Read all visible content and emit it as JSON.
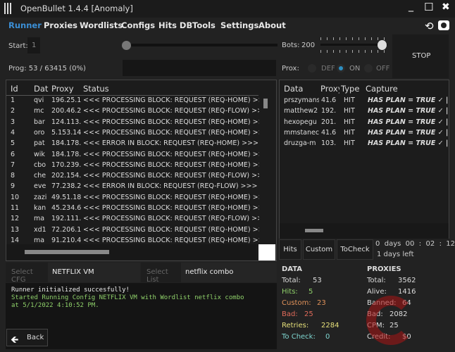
{
  "window": {
    "title": "OpenBullet 1.4.4 [Anomaly]",
    "minimize": "_",
    "maximize": "☐",
    "close": "✖"
  },
  "menu": [
    "Runner",
    "Proxies",
    "Wordlists",
    "Configs",
    "Hits DB",
    "Tools",
    "Settings",
    "About"
  ],
  "accent": "#3b8fd6",
  "controls": {
    "start_label": "Start:",
    "start_value": "1",
    "prog_label": "Prog: 53 / 63415 (0%)",
    "bots_label": "Bots:",
    "bots_value": "200",
    "prox_label": "Prox:",
    "prox_options": [
      "DEF",
      "ON",
      "OFF"
    ],
    "prox_selected": "ON",
    "stop": "STOP",
    "progress_percent": 0
  },
  "left_grid": {
    "headers": [
      "Id",
      "Dat",
      "Proxy",
      "Status"
    ],
    "rows": [
      [
        "1",
        "qvi",
        "196.25.1",
        "<<< PROCESSING BLOCK: REQUEST (REQ-HOME) >>>"
      ],
      [
        "2",
        "mc",
        "200.46.2",
        "<<< PROCESSING BLOCK: REQUEST (REQ-FLOW) >>>"
      ],
      [
        "3",
        "bar",
        "124.113.",
        "<<< PROCESSING BLOCK: REQUEST (REQ-HOME) >>>"
      ],
      [
        "4",
        "oro",
        "5.153.14",
        "<<< PROCESSING BLOCK: REQUEST (REQ-HOME) >>>"
      ],
      [
        "5",
        "pat",
        "184.178.",
        "<<< ERROR IN BLOCK: REQUEST (REQ-HOME) >>>"
      ],
      [
        "6",
        "wik",
        "184.178.",
        "<<< PROCESSING BLOCK: REQUEST (REQ-HOME) >>>"
      ],
      [
        "7",
        "cbo",
        "170.239.",
        "<<< PROCESSING BLOCK: REQUEST (REQ-HOME) >>>"
      ],
      [
        "8",
        "che",
        "202.154.",
        "<<< PROCESSING BLOCK: REQUEST (REQ-FLOW) >>>"
      ],
      [
        "9",
        "eve",
        "77.238.2",
        "<<< ERROR IN BLOCK: REQUEST (REQ-FLOW) >>>"
      ],
      [
        "10",
        "zazi",
        "49.51.18",
        "<<< PROCESSING BLOCK: REQUEST (REQ-HOME) >>>"
      ],
      [
        "11",
        "kan",
        "45.234.6",
        "<<< PROCESSING BLOCK: REQUEST (REQ-HOME) >>>"
      ],
      [
        "12",
        "ma",
        "192.111.",
        "<<< PROCESSING BLOCK: REQUEST (REQ-FLOW) >>>"
      ],
      [
        "13",
        "xd1",
        "72.206.1",
        "<<< PROCESSING BLOCK: REQUEST (REQ-HOME) >>>"
      ],
      [
        "14",
        "ma",
        "91.210.4",
        "<<< PROCESSING BLOCK: REQUEST (REQ-HOME) >>>"
      ]
    ]
  },
  "right_grid": {
    "headers": [
      "Data",
      "Proxy",
      "Type",
      "Capture"
    ],
    "rows": [
      [
        "prszymans",
        "41.6",
        "HIT",
        "HAS PLAN = TRUE ✓ | CON"
      ],
      [
        "matthew2",
        "192.",
        "HIT",
        "HAS PLAN = TRUE ✓ | CON"
      ],
      [
        "hexopegu",
        "201.",
        "HIT",
        "HAS PLAN = TRUE ✓ | CON"
      ],
      [
        "mmstanec",
        "41.6",
        "HIT",
        "HAS PLAN = TRUE ✓ | CON"
      ],
      [
        "druzga-m",
        "103.",
        "HIT",
        "HAS PLAN = TRUE ✓ | CON"
      ]
    ]
  },
  "tabs": [
    "Hits",
    "Custom",
    "ToCheck"
  ],
  "timer": {
    "elapsed": "0  days  00  :  02  :  12",
    "left": "1 days left"
  },
  "select": {
    "cfg_label": "Select CFG",
    "cfg_value": "NETFLIX VM",
    "list_label": "Select List",
    "list_value": "netflix combo"
  },
  "log": [
    "Runner initialized succesfully!",
    "Started Running Config NETFLIX VM  with Wordlist netflix combo",
    "at 5/1/2022 4:10:52 PM."
  ],
  "back": "Back",
  "data_stats": {
    "title": "DATA",
    "items": [
      [
        "Total:",
        "53",
        "#dddddd"
      ],
      [
        "Hits:",
        "5",
        "#8fd16a"
      ],
      [
        "Custom:",
        "23",
        "#e0925a"
      ],
      [
        "Bad:",
        "25",
        "#e06a5a"
      ],
      [
        "Retries:",
        "2284",
        "#e6e07a"
      ],
      [
        "To Check:",
        "0",
        "#7fd6d0"
      ]
    ]
  },
  "proxy_stats": {
    "title": "PROXIES",
    "items": [
      [
        "Total:",
        "3562"
      ],
      [
        "Alive:",
        "1416"
      ],
      [
        "Banned:",
        "64"
      ],
      [
        "Bad:",
        "2082"
      ],
      [
        "CPM:",
        "25"
      ],
      [
        "Credit:",
        "$0"
      ]
    ]
  }
}
